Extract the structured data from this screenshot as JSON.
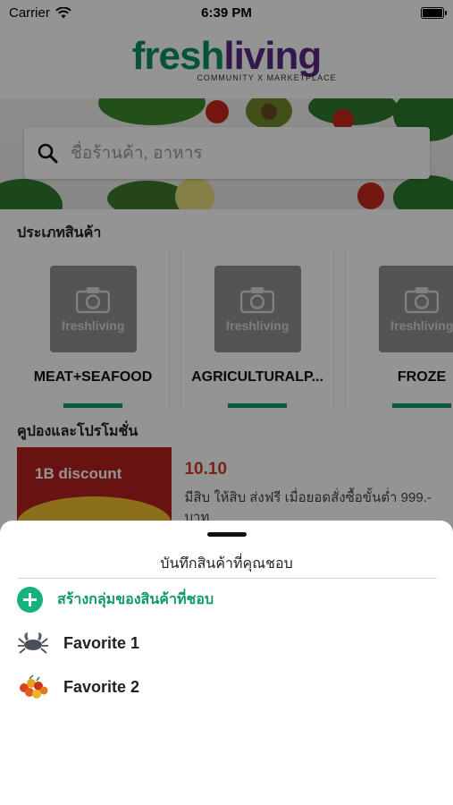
{
  "status_bar": {
    "carrier": "Carrier",
    "time": "6:39 PM"
  },
  "logo": {
    "fresh": "fresh",
    "living": "living",
    "tagline": "COMMUNITY X MARKETPLACE"
  },
  "search": {
    "placeholder": "ชื่อร้านค้า, อาหาร"
  },
  "categories_section": {
    "title": "ประเภทสินค้า",
    "placeholder_logo_text": "freshliving",
    "items": [
      {
        "label": "MEAT+SEAFOOD"
      },
      {
        "label": "AGRICULTURALP..."
      },
      {
        "label": "FROZE"
      }
    ]
  },
  "promo_section": {
    "title": "คูปองและโปรโมชั่น",
    "card": {
      "image_text": "1B discount",
      "title": "10.10",
      "description": "มีสิบ ให้สิบ ส่งฟรี เมื่อยอดสั่งซื้อขั้นต่ำ 999.- บาท"
    }
  },
  "sheet": {
    "title": "บันทึกสินค้าที่คุณชอบ",
    "create_label": "สร้างกลุ่มของสินค้าที่ชอบ",
    "favorites": [
      {
        "label": "Favorite 1",
        "icon": "crab-icon"
      },
      {
        "label": "Favorite 2",
        "icon": "berries-icon"
      }
    ]
  },
  "colors": {
    "brand_green": "#0a8f62",
    "brand_purple": "#5a2a86",
    "accent_green": "#16b27a",
    "promo_red": "#d33a2a"
  }
}
